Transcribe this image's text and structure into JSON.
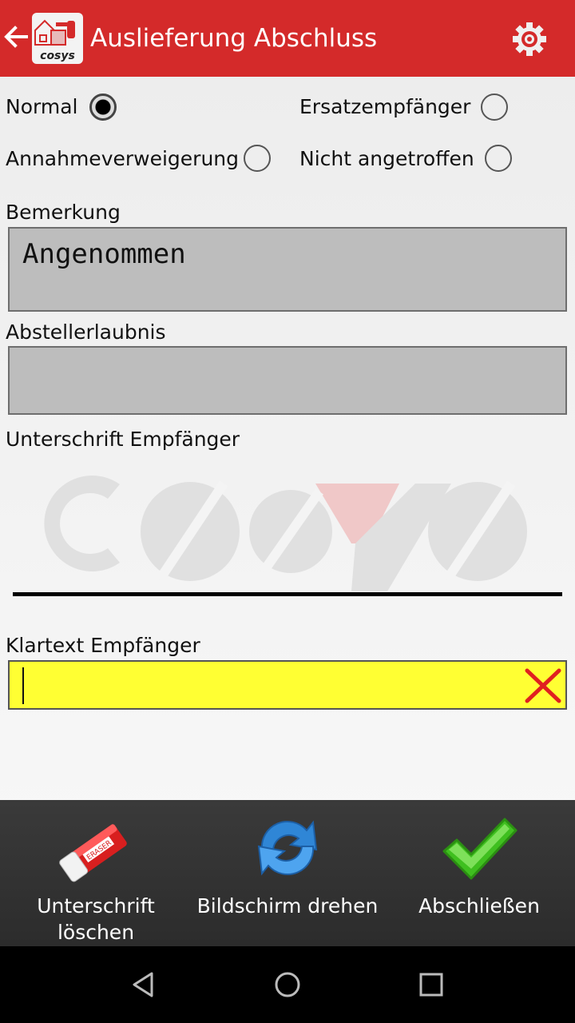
{
  "appbar": {
    "title": "Auslieferung Abschluss",
    "logo_text": "cosys",
    "color": "#d42a2a"
  },
  "options": {
    "normal": "Normal",
    "ersatz": "Ersatzempfänger",
    "annahme": "Annahmeverweigerung",
    "nicht": "Nicht angetroffen",
    "selected": "Normal"
  },
  "bemerkung": {
    "label": "Bemerkung",
    "value": "Angenommen"
  },
  "abstell": {
    "label": "Abstellerlaubnis",
    "value": ""
  },
  "signature": {
    "label": "Unterschrift Empfänger",
    "watermark": "cosys"
  },
  "klartext": {
    "label": "Klartext Empfänger",
    "value": "",
    "color": "#ffff33"
  },
  "bottombar": {
    "clear_label": "Unterschrift löschen",
    "rotate_label": "Bildschirm drehen",
    "finish_label": "Abschließen"
  },
  "icons": {
    "back": "arrow-left-icon",
    "settings": "gear-icon",
    "eraser": "eraser-icon",
    "rotate": "rotate-icon",
    "check": "checkmark-icon"
  }
}
